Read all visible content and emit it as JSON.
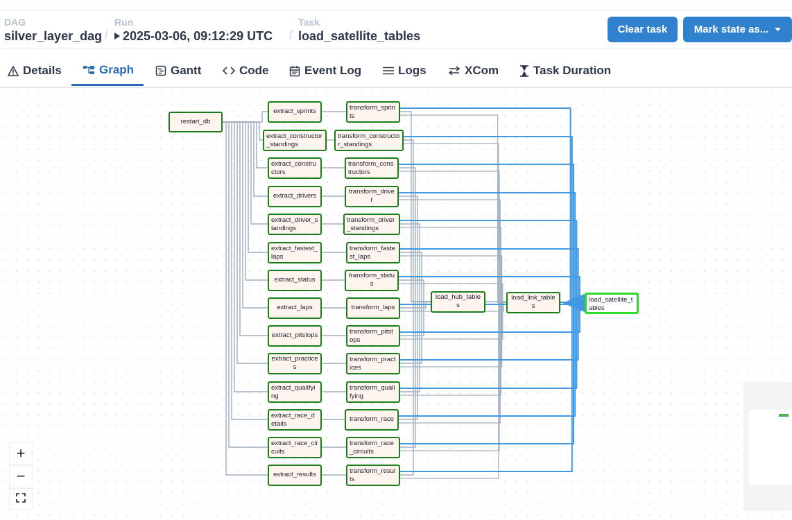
{
  "header": {
    "dag_label": "DAG",
    "dag_value": "silver_layer_dag",
    "run_label": "Run",
    "run_value": "2025-03-06, 09:12:29 UTC",
    "task_label": "Task",
    "task_value": "load_satellite_tables",
    "separator": "/",
    "clear_task": "Clear task",
    "mark_state": "Mark state as..."
  },
  "tabs": [
    {
      "label": "Details",
      "icon": "warning-icon"
    },
    {
      "label": "Graph",
      "icon": "graph-icon"
    },
    {
      "label": "Gantt",
      "icon": "gantt-icon"
    },
    {
      "label": "Code",
      "icon": "code-icon"
    },
    {
      "label": "Event Log",
      "icon": "calendar-icon"
    },
    {
      "label": "Logs",
      "icon": "list-icon"
    },
    {
      "label": "XCom",
      "icon": "arrows-icon"
    },
    {
      "label": "Task Duration",
      "icon": "hourglass-icon"
    }
  ],
  "active_tab": "Graph",
  "graph": {
    "root": "restart_db",
    "extract": [
      "extract_sprints",
      "extract_constructor_standings",
      "extract_constructors",
      "extract_drivers",
      "extract_driver_standings",
      "extract_fastest_laps",
      "extract_status",
      "extract_laps",
      "extract_pitstops",
      "extract_practices",
      "extract_qualifying",
      "extract_race_details",
      "extract_race_circuits",
      "extract_results"
    ],
    "transform": [
      "transform_sprints",
      "transform_constructor_standings",
      "transform_constructors",
      "transform_driver",
      "transform_driver_standings",
      "transform_fastest_laps",
      "transform_status",
      "transform_laps",
      "transform_pitstops",
      "transform_practices",
      "transform_qualifying",
      "transform_race",
      "transform_race_circuits",
      "transform_results"
    ],
    "hub": "load_hub_tables",
    "link": "load_link_tables",
    "satellite": "load_satellite_tables",
    "colors": {
      "node_border": "#1a7f1a",
      "node_fill": "#fff4ee",
      "selected_border": "#2bdc2b",
      "edge_gray": "#a0aec0",
      "edge_blue": "#4299e1"
    }
  },
  "zoom": {
    "in": "+",
    "out": "−",
    "fit": "⛶"
  }
}
